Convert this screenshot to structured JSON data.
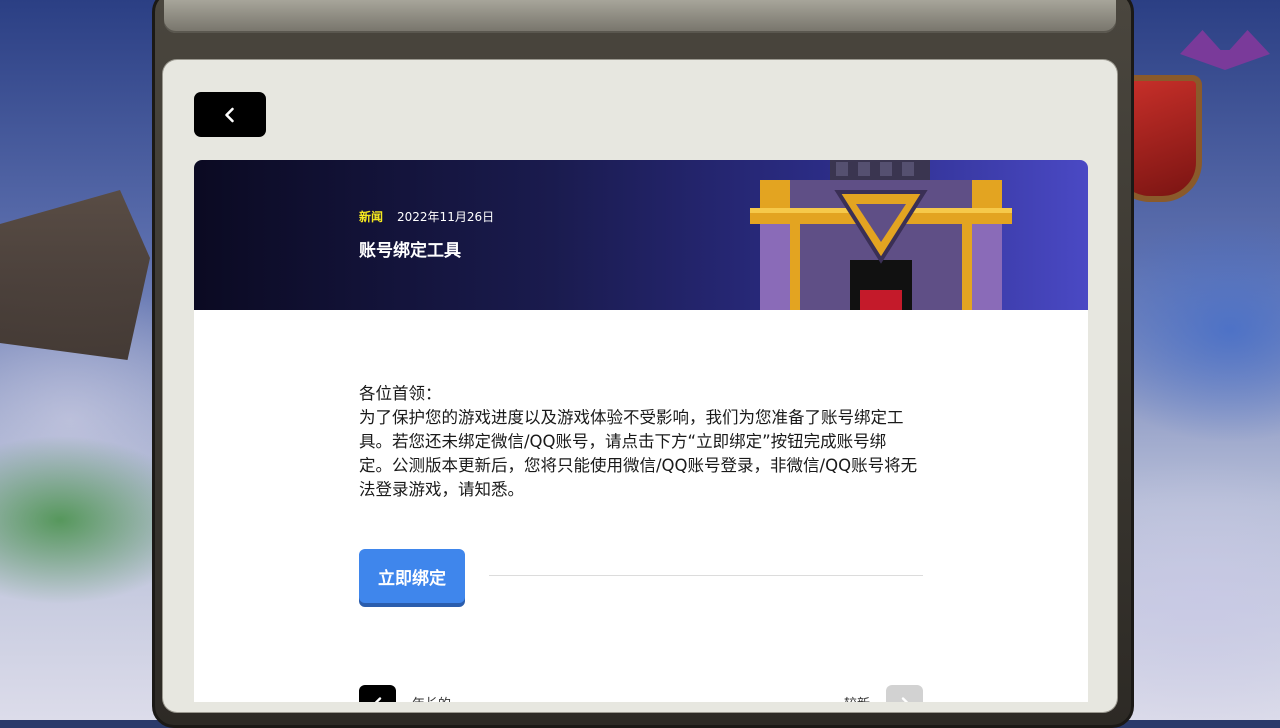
{
  "back_button": {
    "icon": "chevron-left-icon"
  },
  "article": {
    "category": "新闻",
    "date": "2022年11月26日",
    "title": "账号绑定工具",
    "greeting": "各位首领：",
    "body": "为了保护您的游戏进度以及游戏体验不受影响，我们为您准备了账号绑定工具。若您还未绑定微信/QQ账号，请点击下方“立即绑定”按钮完成账号绑定。公测版本更新后，您将只能使用微信/QQ账号登录，非微信/QQ账号将无法登录游戏，请知悉。",
    "action_label": "立即绑定"
  },
  "navigation": {
    "older_label": "年长的",
    "newer_label": "较新"
  },
  "colors": {
    "category": "#f5e81f",
    "action_button": "#3f86ec",
    "panel": "#e7e7e0"
  }
}
